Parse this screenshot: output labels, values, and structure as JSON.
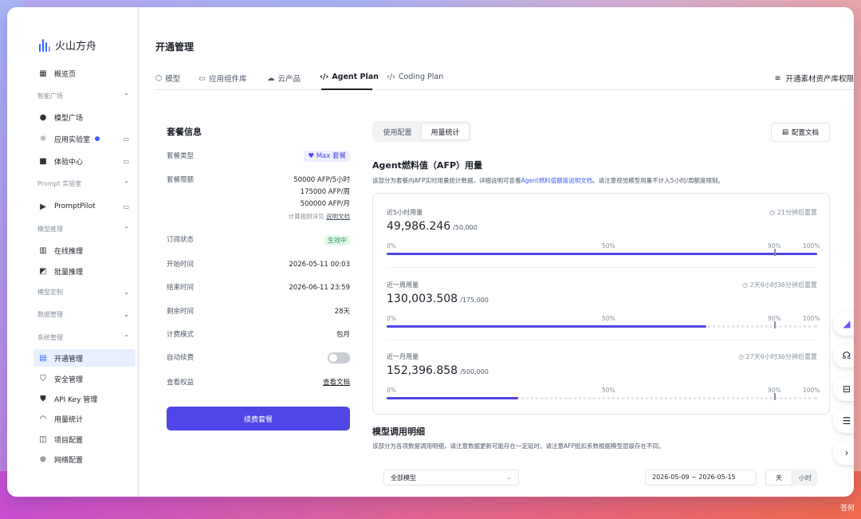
{
  "app": {
    "logo_text": "火山方舟"
  },
  "sidebar": {
    "items": [
      {
        "label": "概览页",
        "icon": "dashboard-icon"
      },
      {
        "label": "智能广场",
        "type": "group"
      },
      {
        "label": "模型广场",
        "icon": "bulb-icon"
      },
      {
        "label": "应用实验室",
        "icon": "atom-icon"
      },
      {
        "label": "体验中心",
        "icon": "box-icon"
      },
      {
        "label": "Prompt 实验室",
        "type": "group"
      },
      {
        "label": "PromptPilot",
        "icon": "terminal-icon"
      },
      {
        "label": "模型推理",
        "type": "group"
      },
      {
        "label": "在线推理",
        "icon": "server-icon"
      },
      {
        "label": "批量推理",
        "icon": "batch-icon"
      },
      {
        "label": "模型定制",
        "type": "group"
      },
      {
        "label": "数据管理",
        "type": "group"
      },
      {
        "label": "系统管理",
        "type": "group"
      },
      {
        "label": "开通管理",
        "icon": "document-icon",
        "active": true
      },
      {
        "label": "安全管理",
        "icon": "shield-icon"
      },
      {
        "label": "API Key 管理",
        "icon": "key-shield-icon"
      },
      {
        "label": "用量统计",
        "icon": "gauge-icon"
      },
      {
        "label": "项目配置",
        "icon": "project-icon"
      },
      {
        "label": "网络配置",
        "icon": "globe-icon"
      }
    ]
  },
  "header": {
    "title": "开通管理",
    "tabs": [
      {
        "label": "模型",
        "icon": "cube-icon"
      },
      {
        "label": "应用组件库",
        "icon": "library-icon"
      },
      {
        "label": "云产品",
        "icon": "cloud-icon"
      },
      {
        "label": "Agent Plan",
        "icon": "code-icon",
        "active": true
      },
      {
        "label": "Coding Plan",
        "icon": "code-icon"
      }
    ],
    "right_link": "开通素材资产库权限"
  },
  "plan": {
    "title": "套餐信息",
    "type_label": "套餐类型",
    "type_value": "Max 套餐",
    "limit_label": "套餐限额",
    "limit_5h": "50000 AFP/5小时",
    "limit_week": "175000 AFP/周",
    "limit_month": "500000 AFP/月",
    "limit_note": "计算规则详见",
    "limit_note_link": "说明文档",
    "status_label": "订阅状态",
    "status_value": "生效中",
    "start_label": "开始时间",
    "start_value": "2026-05-11 00:03",
    "end_label": "结束时间",
    "end_value": "2026-06-11 23:59",
    "remain_label": "剩余时间",
    "remain_value": "28天",
    "billing_label": "计费模式",
    "billing_value": "包月",
    "autorenew_label": "自动续费",
    "autorenew_on": false,
    "rights_label": "查看权益",
    "rights_link": "查看文档",
    "renew_button": "续费套餐"
  },
  "right": {
    "seg_config": "使用配置",
    "seg_stats": "用量统计",
    "doc_button": "配置文档",
    "afp_title": "Agent燃料值（AFP）用量",
    "afp_desc_1": "该部分为套餐内AFP实时用量统计数据，详细说明可查看",
    "afp_desc_link": "Agent燃料值额度说明文档",
    "afp_desc_2": "。请注意视觉模型用量不计入5小时/周额度限制。",
    "ticks": [
      "0%",
      "50%",
      "90%",
      "100%"
    ],
    "usage": [
      {
        "label": "近5小时用量",
        "reset": "21分钟后重置",
        "value": "49,986.246",
        "limit": "/50,000",
        "fraction": 0.9997
      },
      {
        "label": "近一周用量",
        "reset": "2天6小时36分钟后重置",
        "value": "130,003.508",
        "limit": "/175,000",
        "fraction": 0.7429
      },
      {
        "label": "近一月用量",
        "reset": "27天6小时36分钟后重置",
        "value": "152,396.858",
        "limit": "/500,000",
        "fraction": 0.3048
      }
    ],
    "detail_title": "模型调用明细",
    "detail_desc": "该部分为各项数据调用明细，请注意数据更新可能存在一定延时。请注意AFP抵扣系数根据模型层级存在不同。",
    "filter_model": "全部模型",
    "date_range": "2026-05-09  ~  2026-05-15",
    "gran_day": "天",
    "gran_hour": "小时"
  },
  "watermark": "苍何"
}
